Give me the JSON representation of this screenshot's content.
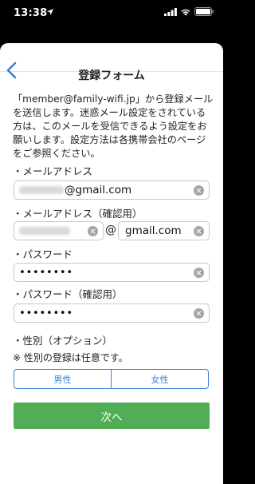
{
  "status": {
    "time": "13:38"
  },
  "nav": {
    "title": "登録フォーム"
  },
  "intro": {
    "text": "「member@family-wifi.jp」から登録メールを送信します。迷惑メール設定をされている方は、このメールを受信できるよう設定をお願いします。設定方法は各携帯会社のページをご参照ください。"
  },
  "email": {
    "label": "・メールアドレス",
    "value_suffix": "@gmail.com"
  },
  "email_confirm": {
    "label": "・メールアドレス（確認用）",
    "at": "@",
    "domain_value": "gmail.com"
  },
  "password": {
    "label": "・パスワード",
    "value": "••••••••"
  },
  "password_confirm": {
    "label": "・パスワード（確認用）",
    "value": "••••••••"
  },
  "gender": {
    "label": "・性別（オプション）",
    "note": "※ 性別の登録は任意です。",
    "options": [
      "男性",
      "女性"
    ]
  },
  "submit": {
    "label": "次へ"
  },
  "colors": {
    "accent": "#3b82d6",
    "primary_button": "#52ad57"
  }
}
